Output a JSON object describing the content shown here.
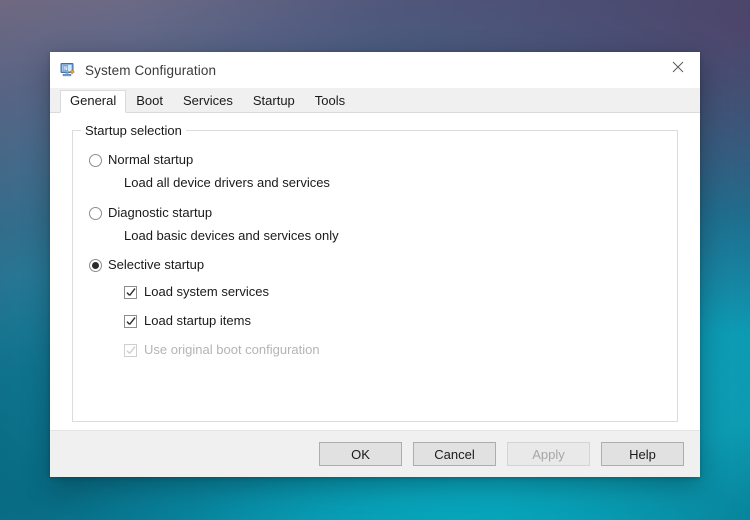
{
  "window": {
    "title": "System Configuration",
    "icon": "system-configuration-icon",
    "close_label": "✕"
  },
  "tabs": [
    {
      "label": "General",
      "active": true
    },
    {
      "label": "Boot",
      "active": false
    },
    {
      "label": "Services",
      "active": false
    },
    {
      "label": "Startup",
      "active": false
    },
    {
      "label": "Tools",
      "active": false
    }
  ],
  "groupbox": {
    "legend": "Startup selection",
    "options": [
      {
        "label": "Normal startup",
        "selected": false,
        "description": "Load all device drivers and services"
      },
      {
        "label": "Diagnostic startup",
        "selected": false,
        "description": "Load basic devices and services only"
      },
      {
        "label": "Selective startup",
        "selected": true,
        "description": ""
      }
    ],
    "checkboxes": [
      {
        "label": "Load system services",
        "checked": true,
        "disabled": false
      },
      {
        "label": "Load startup items",
        "checked": true,
        "disabled": false
      },
      {
        "label": "Use original boot configuration",
        "checked": true,
        "disabled": true
      }
    ]
  },
  "buttons": [
    {
      "label": "OK",
      "disabled": false
    },
    {
      "label": "Cancel",
      "disabled": false
    },
    {
      "label": "Apply",
      "disabled": true
    },
    {
      "label": "Help",
      "disabled": false
    }
  ],
  "colors": {
    "window_bg": "#ffffff",
    "chrome_bg": "#f0f0f0",
    "border": "#dcdcdc",
    "text": "#1a1a1a",
    "disabled_text": "#b4b4b4",
    "accent": "#0078d7",
    "wallpaper_teal": "#0e9fb9",
    "wallpaper_purple": "#5d6a8d"
  }
}
